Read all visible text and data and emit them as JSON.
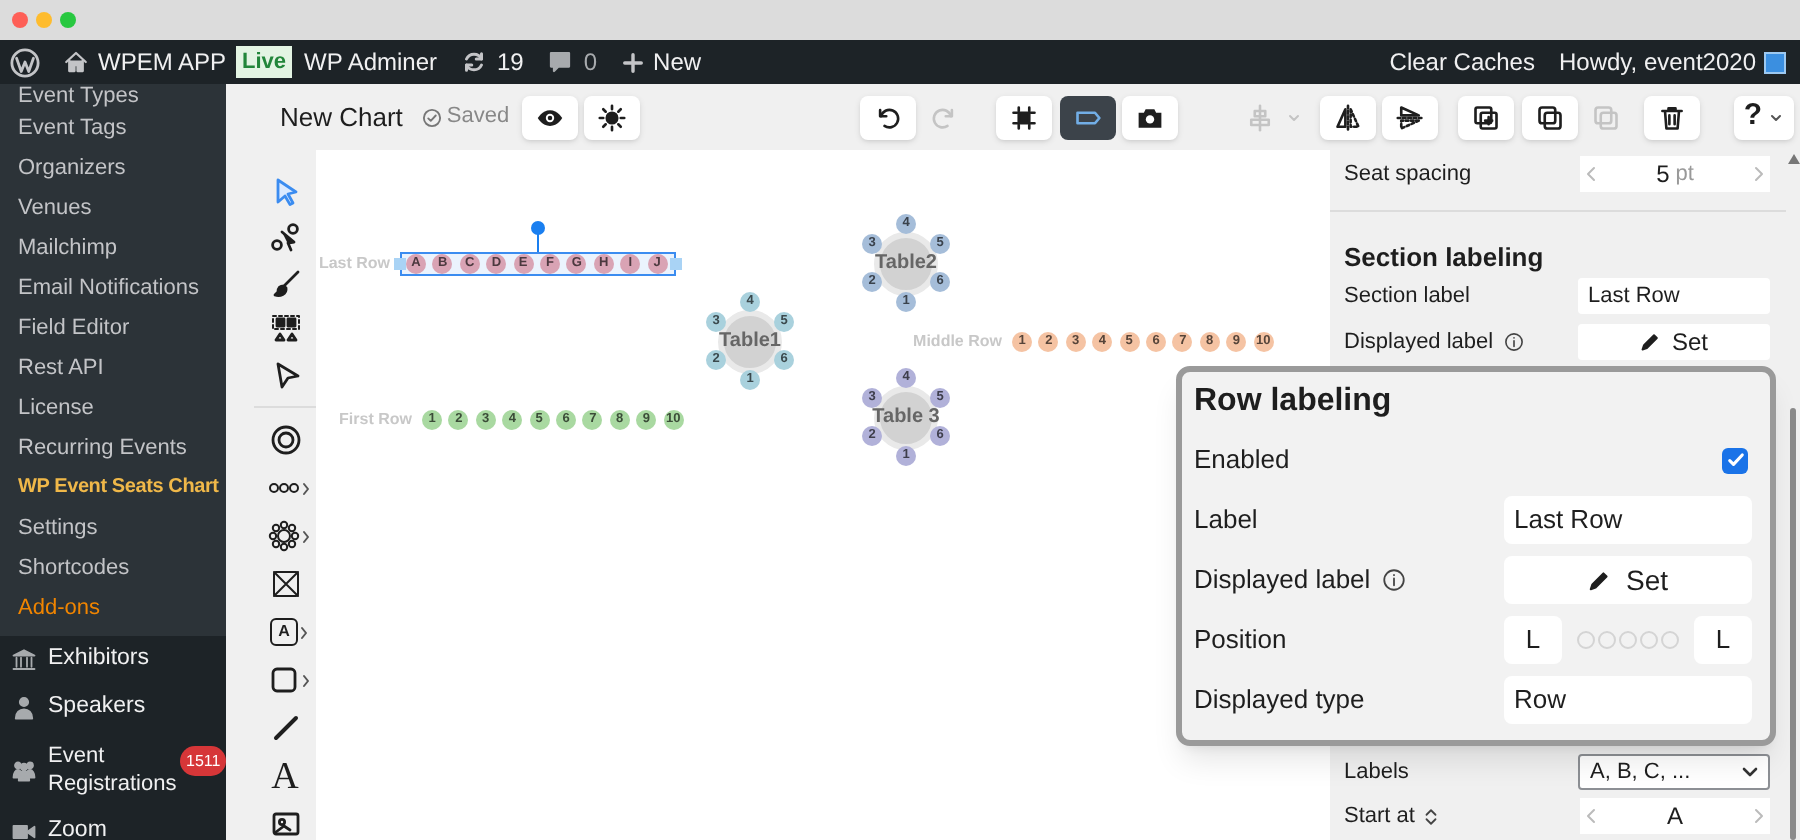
{
  "admin_bar": {
    "site": "WPEM APP",
    "env_badge": "Live",
    "adminer": "WP Adminer",
    "updates": "19",
    "comments": "0",
    "new": "New",
    "clear_caches": "Clear Caches",
    "greeting": "Howdy, event2020"
  },
  "sidebar": {
    "sub_items": [
      {
        "label": "Event Types",
        "selected": false,
        "kind": "link"
      },
      {
        "label": "Event Tags",
        "selected": false,
        "kind": "link"
      },
      {
        "label": "Organizers",
        "selected": false,
        "kind": "link"
      },
      {
        "label": "Venues",
        "selected": false,
        "kind": "link"
      },
      {
        "label": "Mailchimp",
        "selected": false,
        "kind": "link"
      },
      {
        "label": "Email Notifications",
        "selected": false,
        "kind": "link"
      },
      {
        "label": "Field Editor",
        "selected": false,
        "kind": "link"
      },
      {
        "label": "Rest API",
        "selected": false,
        "kind": "link"
      },
      {
        "label": "License",
        "selected": false,
        "kind": "link"
      },
      {
        "label": "Recurring Events",
        "selected": false,
        "kind": "link"
      },
      {
        "label": "WP Event Seats Chart",
        "selected": true,
        "kind": "link"
      },
      {
        "label": "Settings",
        "selected": false,
        "kind": "link"
      },
      {
        "label": "Shortcodes",
        "selected": false,
        "kind": "link"
      },
      {
        "label": "Add-ons",
        "selected": false,
        "kind": "addon"
      }
    ],
    "items": [
      {
        "label": "Exhibitors"
      },
      {
        "label": "Speakers"
      },
      {
        "label": "Event Registrations",
        "badge": "1511"
      },
      {
        "label": "Zoom"
      }
    ]
  },
  "editor": {
    "title": "New Chart",
    "save_status": "Saved",
    "help": "?",
    "toolbar": [
      {
        "selected": false,
        "disabled": false
      },
      {
        "selected": false,
        "disabled": false
      },
      {
        "selected": false,
        "disabled": false
      },
      {
        "selected": false,
        "disabled": true
      },
      {
        "selected": false,
        "disabled": false
      },
      {
        "selected": true,
        "disabled": false
      },
      {
        "selected": false,
        "disabled": false
      },
      {
        "selected": false,
        "disabled": true
      },
      {
        "selected": false,
        "disabled": false
      },
      {
        "selected": false,
        "disabled": false
      },
      {
        "selected": false,
        "disabled": false
      },
      {
        "selected": false,
        "disabled": false
      },
      {
        "selected": false,
        "disabled": true
      },
      {
        "selected": false,
        "disabled": false
      }
    ]
  },
  "tools": [
    {
      "selected": true,
      "submenu": false
    },
    {
      "selected": false,
      "submenu": false
    },
    {
      "selected": false,
      "submenu": false
    },
    {
      "selected": false,
      "submenu": false
    },
    {
      "selected": false,
      "submenu": false
    },
    {
      "selected": false,
      "submenu": false
    },
    {
      "selected": false,
      "submenu": true
    },
    {
      "selected": false,
      "submenu": true
    },
    {
      "selected": false,
      "submenu": false
    },
    {
      "label": "A",
      "selected": false,
      "submenu": true
    },
    {
      "selected": false,
      "submenu": true
    },
    {
      "selected": false,
      "submenu": false
    },
    {
      "label": "A",
      "selected": false,
      "submenu": false
    },
    {
      "selected": false,
      "submenu": false
    }
  ],
  "canvas": {
    "rows": [
      {
        "label": "Last Row",
        "color": "#d9a3b4",
        "selected": true,
        "seats": [
          "A",
          "B",
          "C",
          "D",
          "E",
          "F",
          "G",
          "H",
          "I",
          "J"
        ]
      },
      {
        "label": "Middle Row",
        "color": "#f5c3a3",
        "selected": false,
        "seats": [
          "1",
          "2",
          "3",
          "4",
          "5",
          "6",
          "7",
          "8",
          "9",
          "10"
        ]
      },
      {
        "label": "First Row",
        "color": "#a9d9a1",
        "selected": false,
        "seats": [
          "1",
          "2",
          "3",
          "4",
          "5",
          "6",
          "7",
          "8",
          "9",
          "10"
        ]
      }
    ],
    "tables": [
      {
        "name": "Table2",
        "color": "#a5bdd9",
        "seats": [
          "4",
          "5",
          "6",
          "1",
          "2",
          "3"
        ]
      },
      {
        "name": "Table1",
        "color": "#a9d1dd",
        "seats": [
          "4",
          "5",
          "6",
          "1",
          "2",
          "3"
        ]
      },
      {
        "name": "Table 3",
        "color": "#b1b1d9",
        "seats": [
          "4",
          "5",
          "6",
          "1",
          "2",
          "3"
        ]
      }
    ]
  },
  "panel": {
    "seat_spacing": {
      "label": "Seat spacing",
      "value": "5",
      "unit": "pt"
    },
    "section_heading": "Section labeling",
    "section_label": {
      "label": "Section label",
      "value": "Last Row"
    },
    "displayed_label": {
      "label": "Displayed label",
      "button": "Set"
    },
    "labels": {
      "label": "Labels",
      "value": "A, B, C, ..."
    },
    "start_at": {
      "label": "Start at",
      "value": "A"
    }
  },
  "popup": {
    "title": "Row labeling",
    "enabled": {
      "label": "Enabled",
      "checked": true
    },
    "label": {
      "label": "Label",
      "value": "Last Row"
    },
    "displayed_label": {
      "label": "Displayed label",
      "button": "Set"
    },
    "position": {
      "label": "Position",
      "left": "L",
      "right": "L"
    },
    "displayed_type": {
      "label": "Displayed type",
      "value": "Row"
    }
  }
}
